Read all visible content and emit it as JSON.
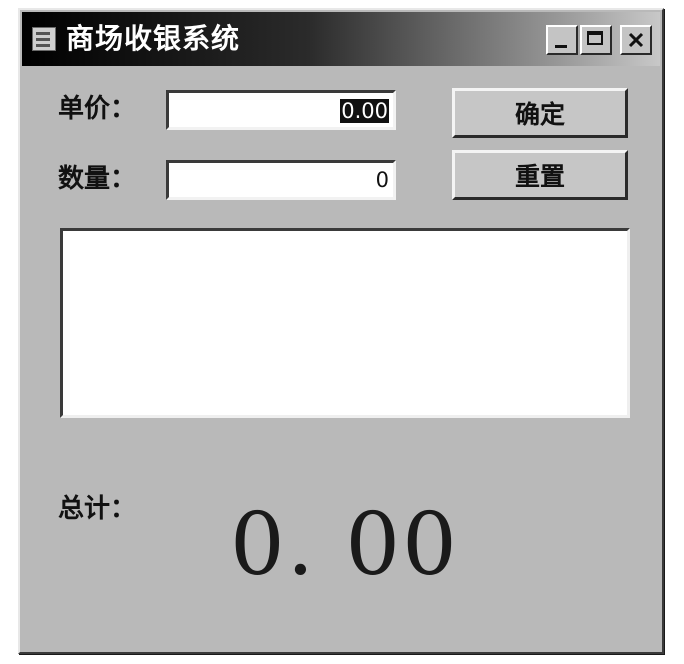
{
  "window": {
    "title": "商场收银系统"
  },
  "form": {
    "price_label": "单价：",
    "price_value": "0.00",
    "quantity_label": "数量：",
    "quantity_value": "0",
    "total_label": "总计：",
    "total_value": "0. 00"
  },
  "buttons": {
    "confirm_label": "确定",
    "reset_label": "重置"
  },
  "colors": {
    "window_bg": "#b9b9b9",
    "titlebar_dark": "#000000",
    "field_bg": "#ffffff"
  }
}
